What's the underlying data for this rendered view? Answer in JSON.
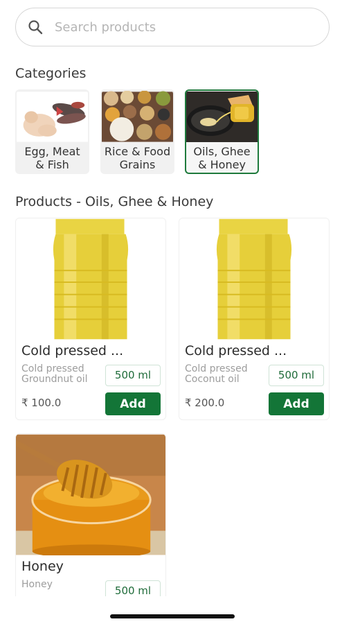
{
  "search": {
    "placeholder": "Search products"
  },
  "categories": {
    "title": "Categories",
    "items": [
      {
        "label": "Egg, Meat\n& Fish"
      },
      {
        "label": "Rice & Food\nGrains"
      },
      {
        "label": "Oils, Ghee\n& Honey",
        "selected": true
      }
    ]
  },
  "products": {
    "title": "Products - Oils, Ghee & Honey",
    "items": [
      {
        "name": "Cold pressed ...",
        "desc": "Cold pressed\nGroundnut oil",
        "size": "500 ml",
        "price": "₹ 100.0",
        "add": "Add"
      },
      {
        "name": "Cold pressed ...",
        "desc": "Cold pressed\nCoconut oil",
        "size": "500 ml",
        "price": "₹ 200.0",
        "add": "Add"
      },
      {
        "name": "Honey",
        "desc": "Honey",
        "size": "500 ml"
      }
    ]
  },
  "colors": {
    "accent": "#137537",
    "selected_border": "#1e7a3c"
  }
}
